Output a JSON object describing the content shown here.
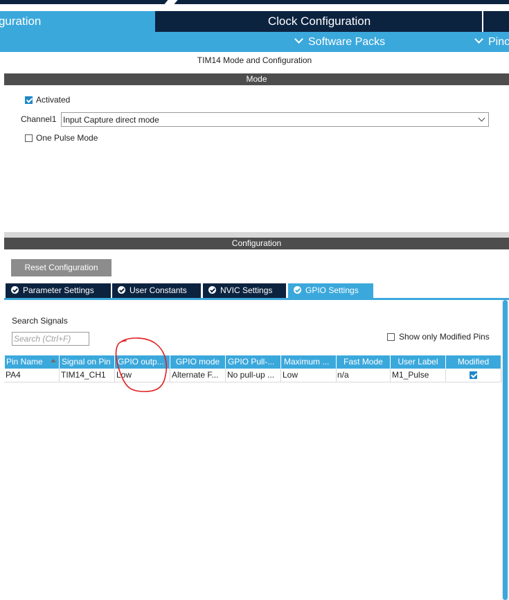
{
  "tabs": {
    "pinout": "nfiguration",
    "clock": "Clock Configuration"
  },
  "subbar": {
    "software_packs": "Software Packs",
    "pinout": "Pino"
  },
  "panel": {
    "title": "TIM14 Mode and Configuration",
    "mode_header": "Mode",
    "activated_label": "Activated",
    "activated_checked": true,
    "channel_label": "Channel1",
    "channel_value": "Input Capture direct mode",
    "one_pulse_label": "One Pulse Mode",
    "one_pulse_checked": false,
    "config_header": "Configuration",
    "reset_button": "Reset Configuration"
  },
  "config_tabs": [
    {
      "label": "Parameter Settings",
      "active": false
    },
    {
      "label": "User Constants",
      "active": false
    },
    {
      "label": "NVIC Settings",
      "active": false
    },
    {
      "label": "GPIO Settings",
      "active": true
    }
  ],
  "gpio": {
    "search_label": "Search Signals",
    "search_placeholder": "Search (Ctrl+F)",
    "show_modified_label": "Show only Modified Pins",
    "columns": [
      "Pin Name",
      "Signal on Pin",
      "GPIO outp...",
      "GPIO mode",
      "GPIO Pull-...",
      "Maximum ...",
      "Fast Mode",
      "User Label",
      "Modified"
    ],
    "rows": [
      {
        "pin_name": "PA4",
        "signal": "TIM14_CH1",
        "gpio_output": "Low",
        "gpio_mode": "Alternate F...",
        "gpio_pull": "No pull-up ...",
        "maximum": "Low",
        "fast_mode": "n/a",
        "user_label": "M1_Pulse",
        "modified": true
      }
    ]
  },
  "colors": {
    "navy": "#0c2340",
    "accent_blue": "#3ba8dc",
    "header_gray": "#4d4d4d",
    "annotation_red": "#e02020"
  }
}
